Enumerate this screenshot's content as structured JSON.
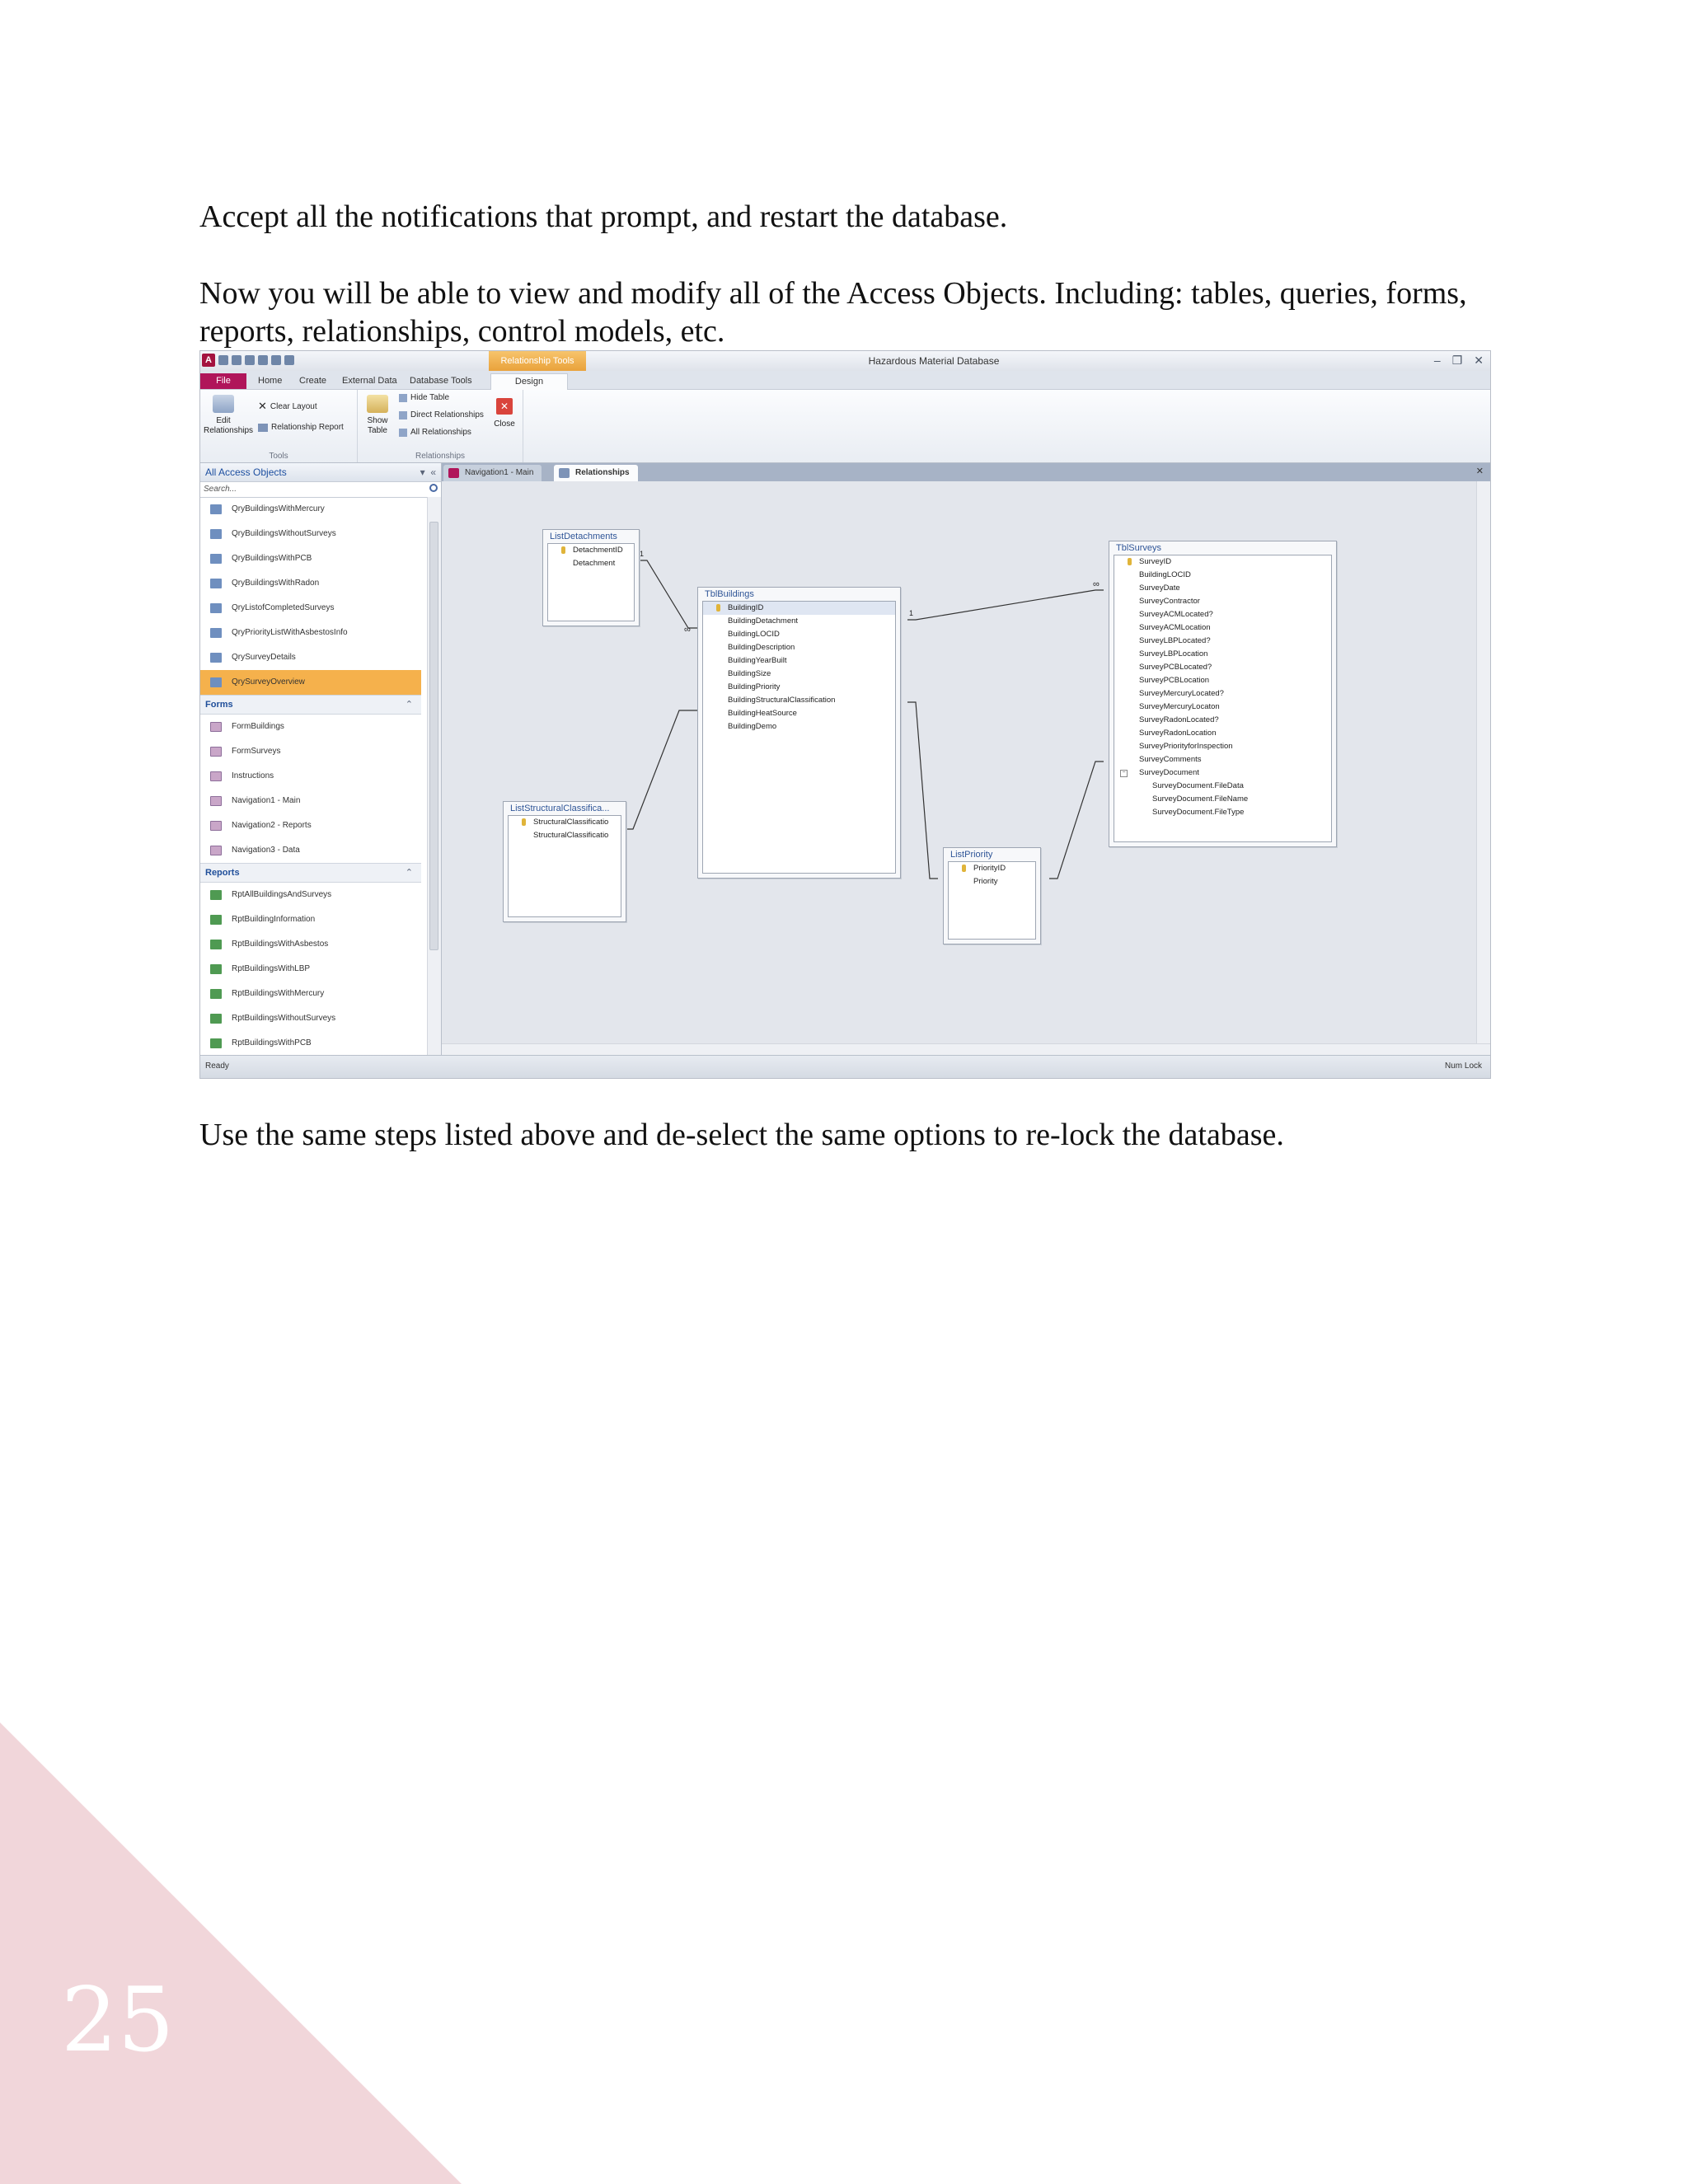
{
  "text": {
    "p1": "Accept all the notifications that prompt, and restart the database.",
    "p2": "Now you will be able to view and modify all of the Access Objects. Including: tables, queries, forms, reports, relationships, control models, etc.",
    "p3": "Use the same steps listed above and de-select the same options to re-lock the database."
  },
  "page_number": "25",
  "colors": {
    "accent": "#b0155a",
    "selection": "#f5b14c",
    "corner": "#f1d6da",
    "context_tab": "#e9a23b"
  },
  "screenshot": {
    "window_title": "Hazardous Material Database",
    "contextual_tab": "Relationship Tools",
    "tabs": [
      "File",
      "Home",
      "Create",
      "External Data",
      "Database Tools",
      "Design"
    ],
    "active_tab": "Design",
    "ribbon": {
      "edit_relationships": "Edit Relationships",
      "clear_layout": "Clear Layout",
      "relationship_report": "Relationship Report",
      "tools_group": "Tools",
      "show_table": "Show Table",
      "hide_table": "Hide Table",
      "direct_relationships": "Direct Relationships",
      "all_relationships": "All Relationships",
      "close": "Close",
      "relationships_group": "Relationships"
    },
    "nav": {
      "title": "All Access Objects",
      "search_placeholder": "Search...",
      "queries": [
        "QryBuildingsWithMercury",
        "QryBuildingsWithoutSurveys",
        "QryBuildingsWithPCB",
        "QryBuildingsWithRadon",
        "QryListofCompletedSurveys",
        "QryPriorityListWithAsbestosInfo",
        "QrySurveyDetails",
        "QrySurveyOverview"
      ],
      "selected_query": "QrySurveyOverview",
      "forms_header": "Forms",
      "forms": [
        "FormBuildings",
        "FormSurveys",
        "Instructions",
        "Navigation1 - Main",
        "Navigation2 - Reports",
        "Navigation3 - Data"
      ],
      "reports_header": "Reports",
      "reports": [
        "RptAllBuildingsAndSurveys",
        "RptBuildingInformation",
        "RptBuildingsWithAsbestos",
        "RptBuildingsWithLBP",
        "RptBuildingsWithMercury",
        "RptBuildingsWithoutSurveys",
        "RptBuildingsWithPCB"
      ]
    },
    "doc_tabs": [
      "Navigation1 - Main",
      "Relationships"
    ],
    "tables": {
      "list_detachments": {
        "title": "ListDetachments",
        "fields": [
          "DetachmentID",
          "Detachment"
        ]
      },
      "tbl_buildings": {
        "title": "TblBuildings",
        "fields": [
          "BuildingID",
          "BuildingDetachment",
          "BuildingLOCID",
          "BuildingDescription",
          "BuildingYearBuilt",
          "BuildingSize",
          "BuildingPriority",
          "BuildingStructuralClassification",
          "BuildingHeatSource",
          "BuildingDemo"
        ]
      },
      "list_structural": {
        "title": "ListStructuralClassifica...",
        "fields": [
          "StructuralClassificatio",
          "StructuralClassificatio"
        ]
      },
      "list_priority": {
        "title": "ListPriority",
        "fields": [
          "PriorityID",
          "Priority"
        ]
      },
      "tbl_surveys": {
        "title": "TblSurveys",
        "fields": [
          "SurveyID",
          "BuildingLOCID",
          "SurveyDate",
          "SurveyContractor",
          "SurveyACMLocated?",
          "SurveyACMLocation",
          "SurveyLBPLocated?",
          "SurveyLBPLocation",
          "SurveyPCBLocated?",
          "SurveyPCBLocation",
          "SurveyMercuryLocated?",
          "SurveyMercuryLocaton",
          "SurveyRadonLocated?",
          "SurveyRadonLocation",
          "SurveyPriorityforInspection",
          "SurveyComments",
          "SurveyDocument",
          "SurveyDocument.FileData",
          "SurveyDocument.FileName",
          "SurveyDocument.FileType"
        ]
      }
    },
    "rel_one": "1",
    "rel_many": "∞",
    "status_left": "Ready",
    "status_right": "Num Lock"
  }
}
